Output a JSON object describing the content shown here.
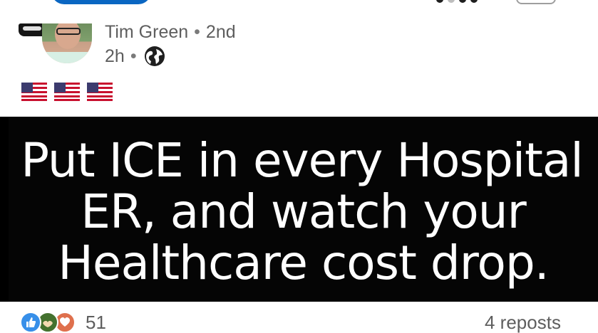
{
  "post": {
    "author": {
      "name": "Tim Green",
      "degree": "2nd",
      "avatar_icon": "profile-photo"
    },
    "meta": {
      "time": "2h",
      "visibility_icon": "globe-icon"
    },
    "caption_icons": [
      "us-flag",
      "us-flag",
      "us-flag"
    ],
    "image_text": {
      "line1": "Put ICE in every Hospital",
      "line2": "ER, and watch your",
      "line3": "Healthcare cost drop."
    },
    "social": {
      "reaction_icons": [
        "like-icon",
        "support-icon",
        "love-icon"
      ],
      "reaction_count": "51",
      "reposts": "4 reposts"
    }
  },
  "colors": {
    "accent": "#0a66c2",
    "text_secondary": "#5e5e5e",
    "image_bg": "#050505"
  }
}
